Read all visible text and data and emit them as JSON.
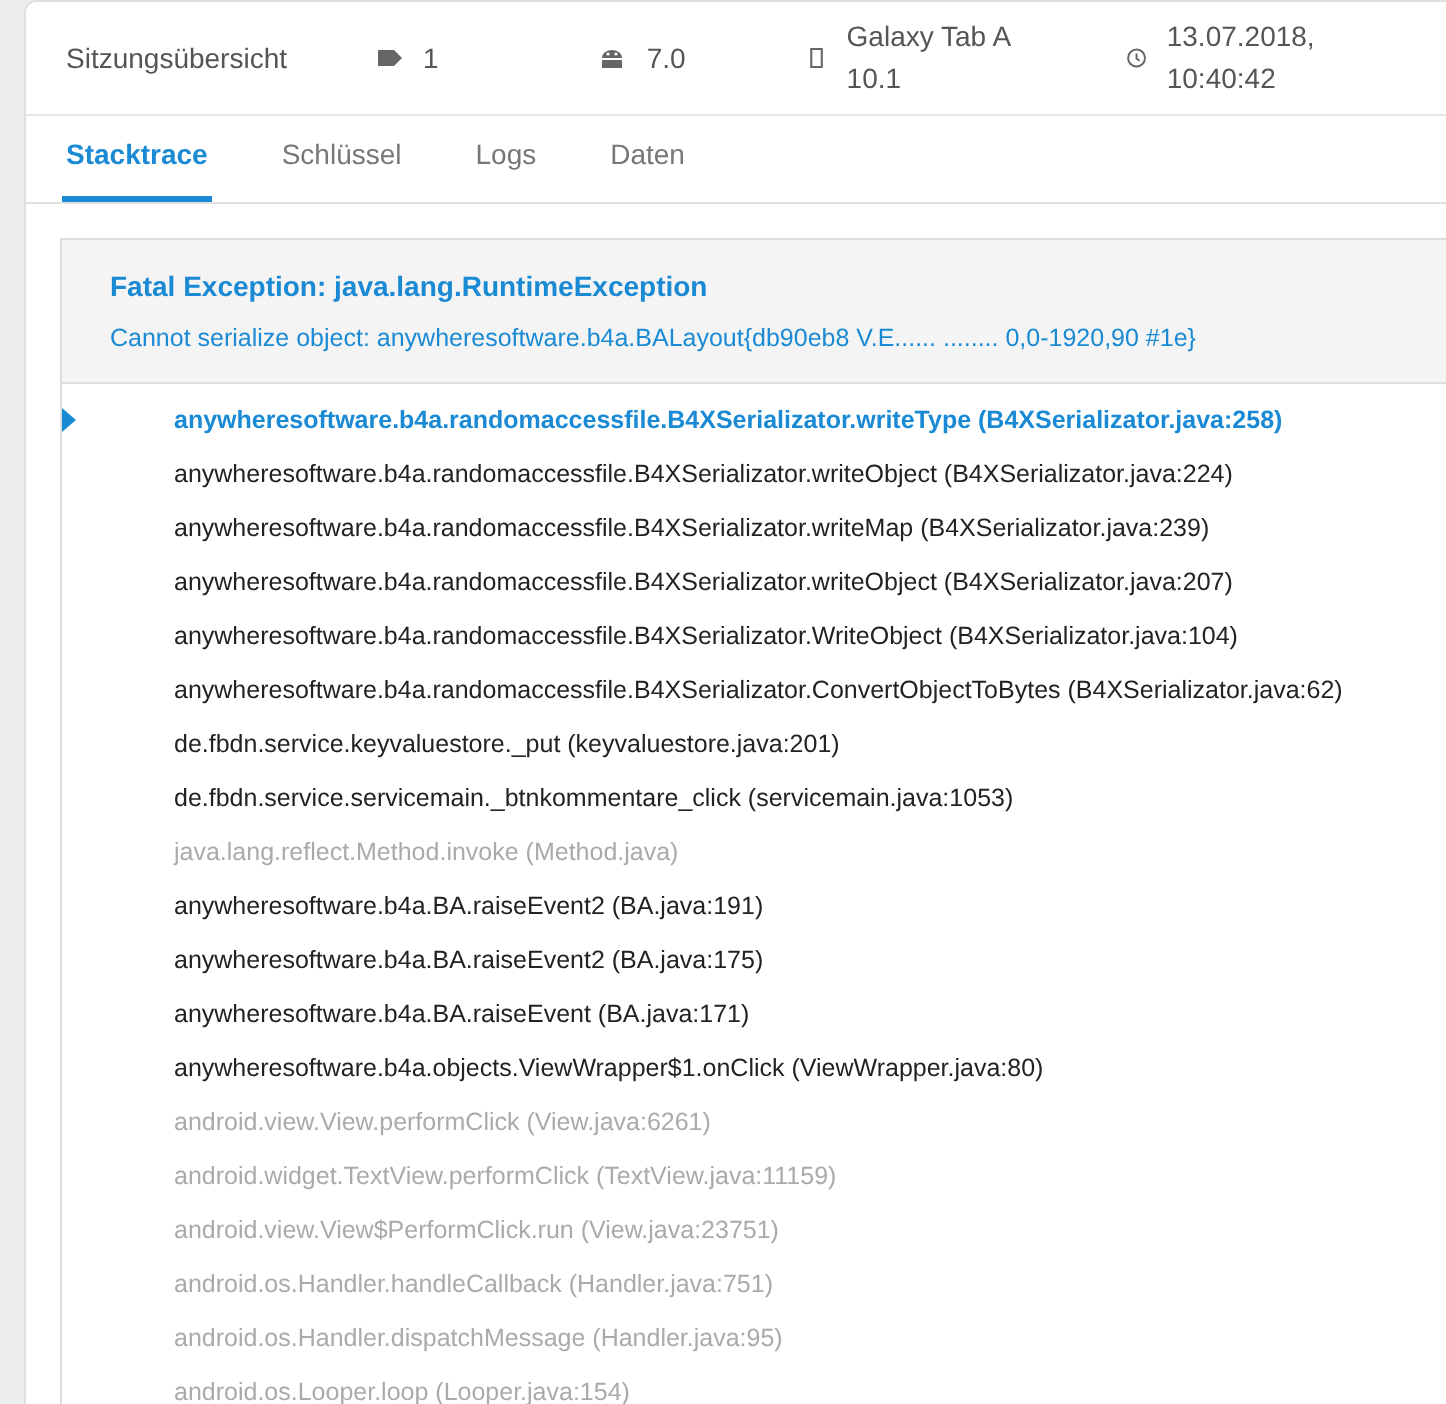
{
  "header": {
    "title": "Sitzungsübersicht",
    "items": [
      {
        "kind": "tag",
        "text": "1"
      },
      {
        "kind": "android",
        "text": "7.0"
      },
      {
        "kind": "device",
        "text": "Galaxy Tab A 10.1"
      },
      {
        "kind": "clock",
        "text": "13.07.2018, 10:40:42"
      }
    ]
  },
  "tabs": [
    {
      "label": "Stacktrace",
      "selected": true
    },
    {
      "label": "Schlüssel",
      "selected": false
    },
    {
      "label": "Logs",
      "selected": false
    },
    {
      "label": "Daten",
      "selected": false
    }
  ],
  "exception": {
    "title": "Fatal Exception: java.lang.RuntimeException",
    "message": "Cannot serialize object: anywheresoftware.b4a.BALayout{db90eb8 V.E...... ........ 0,0-1920,90 #1e}"
  },
  "frames": [
    {
      "text": "anywheresoftware.b4a.randomaccessfile.B4XSerializator.writeType (B4XSerializator.java:258)",
      "kind": "app",
      "selected": true
    },
    {
      "text": "anywheresoftware.b4a.randomaccessfile.B4XSerializator.writeObject (B4XSerializator.java:224)",
      "kind": "app",
      "selected": false
    },
    {
      "text": "anywheresoftware.b4a.randomaccessfile.B4XSerializator.writeMap (B4XSerializator.java:239)",
      "kind": "app",
      "selected": false
    },
    {
      "text": "anywheresoftware.b4a.randomaccessfile.B4XSerializator.writeObject (B4XSerializator.java:207)",
      "kind": "app",
      "selected": false
    },
    {
      "text": "anywheresoftware.b4a.randomaccessfile.B4XSerializator.WriteObject (B4XSerializator.java:104)",
      "kind": "app",
      "selected": false
    },
    {
      "text": "anywheresoftware.b4a.randomaccessfile.B4XSerializator.ConvertObjectToBytes (B4XSerializator.java:62)",
      "kind": "app",
      "selected": false
    },
    {
      "text": "de.fbdn.service.keyvaluestore._put (keyvaluestore.java:201)",
      "kind": "app",
      "selected": false
    },
    {
      "text": "de.fbdn.service.servicemain._btnkommentare_click (servicemain.java:1053)",
      "kind": "app",
      "selected": false
    },
    {
      "text": "java.lang.reflect.Method.invoke (Method.java)",
      "kind": "system",
      "selected": false
    },
    {
      "text": "anywheresoftware.b4a.BA.raiseEvent2 (BA.java:191)",
      "kind": "app",
      "selected": false
    },
    {
      "text": "anywheresoftware.b4a.BA.raiseEvent2 (BA.java:175)",
      "kind": "app",
      "selected": false
    },
    {
      "text": "anywheresoftware.b4a.BA.raiseEvent (BA.java:171)",
      "kind": "app",
      "selected": false
    },
    {
      "text": "anywheresoftware.b4a.objects.ViewWrapper$1.onClick (ViewWrapper.java:80)",
      "kind": "app",
      "selected": false
    },
    {
      "text": "android.view.View.performClick (View.java:6261)",
      "kind": "system",
      "selected": false
    },
    {
      "text": "android.widget.TextView.performClick (TextView.java:11159)",
      "kind": "system",
      "selected": false
    },
    {
      "text": "android.view.View$PerformClick.run (View.java:23751)",
      "kind": "system",
      "selected": false
    },
    {
      "text": "android.os.Handler.handleCallback (Handler.java:751)",
      "kind": "system",
      "selected": false
    },
    {
      "text": "android.os.Handler.dispatchMessage (Handler.java:95)",
      "kind": "system",
      "selected": false
    },
    {
      "text": "android.os.Looper.loop (Looper.java:154)",
      "kind": "system",
      "selected": false
    }
  ]
}
